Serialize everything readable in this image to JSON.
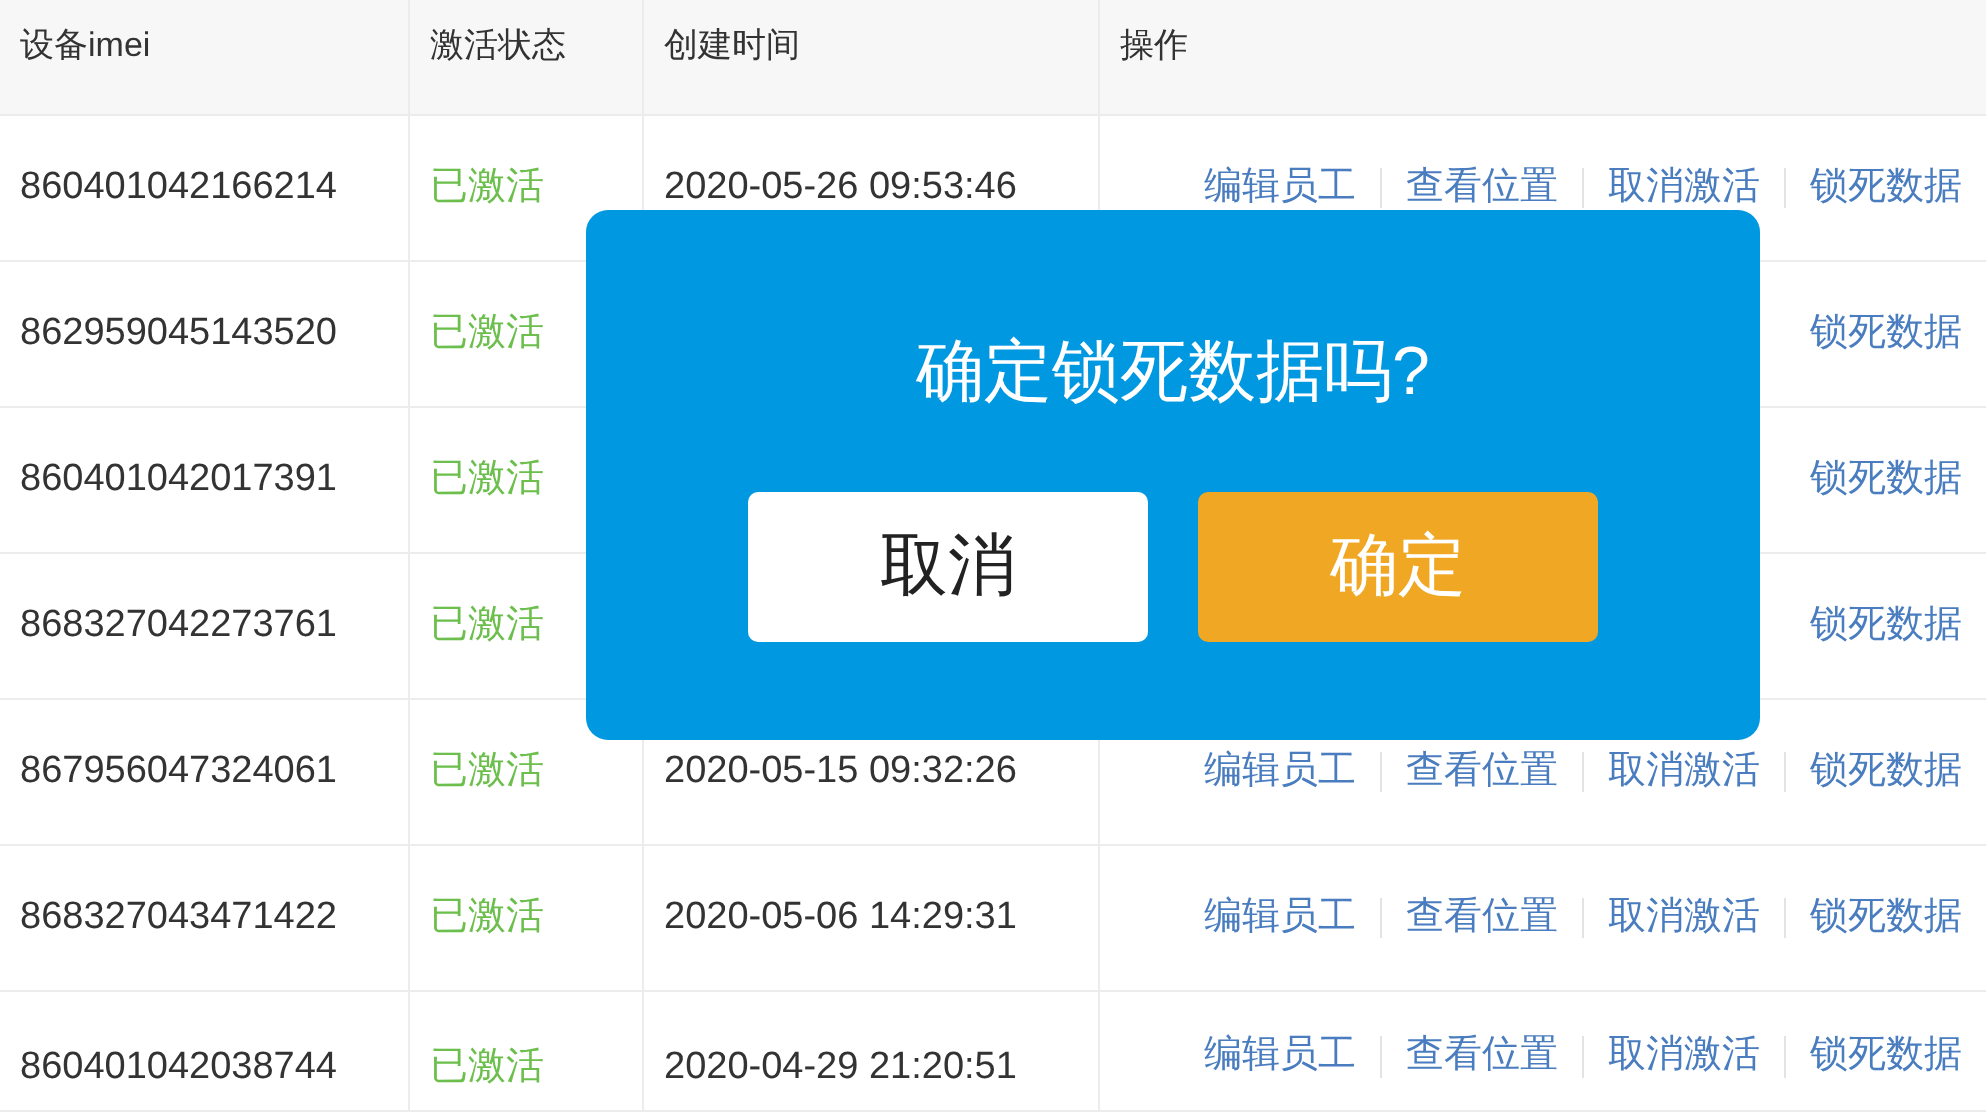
{
  "table": {
    "columns": [
      "设备imei",
      "激活状态",
      "创建时间",
      "操作"
    ],
    "rows": [
      {
        "imei": "860401042166214",
        "status": "已激活",
        "created": "2020-05-26 09:53:46",
        "actions": [
          "编辑员工",
          "查看位置",
          "取消激活",
          "锁死数据"
        ]
      },
      {
        "imei": "862959045143520",
        "status": "已激活",
        "actions": [
          "锁死数据"
        ]
      },
      {
        "imei": "860401042017391",
        "status": "已激活",
        "actions": [
          "锁死数据"
        ]
      },
      {
        "imei": "868327042273761",
        "status": "已激活",
        "actions": [
          "锁死数据"
        ]
      },
      {
        "imei": "867956047324061",
        "status": "已激活",
        "created": "2020-05-15 09:32:26",
        "actions": [
          "编辑员工",
          "查看位置",
          "取消激活",
          "锁死数据"
        ]
      },
      {
        "imei": "868327043471422",
        "status": "已激活",
        "created": "2020-05-06 14:29:31",
        "actions": [
          "编辑员工",
          "查看位置",
          "取消激活",
          "锁死数据"
        ]
      },
      {
        "imei": "860401042038744",
        "status": "已激活",
        "created": "2020-04-29 21:20:51",
        "actions": [
          "编辑员工",
          "查看位置",
          "取消激活",
          "锁死数据"
        ]
      }
    ]
  },
  "dialog": {
    "message": "确定锁死数据吗?",
    "buttons": [
      {
        "label": "取消",
        "kind": "secondary"
      },
      {
        "label": "确定",
        "kind": "primary"
      }
    ]
  }
}
